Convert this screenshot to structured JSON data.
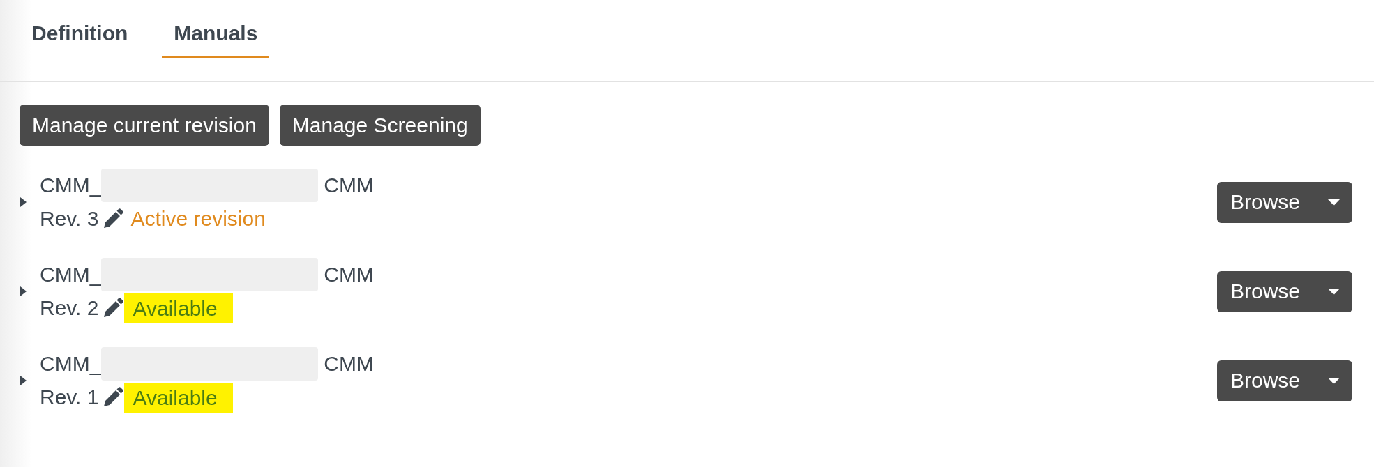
{
  "tabs": [
    {
      "label": "Definition",
      "selected": false
    },
    {
      "label": "Manuals",
      "selected": true
    }
  ],
  "actions": [
    "Manage current revision",
    "Manage Screening"
  ],
  "manuals": [
    {
      "expanded": false,
      "title_start": "CMM_",
      "title_end": "CMM",
      "revision": "Rev. 3",
      "status": {
        "kind": "active",
        "label": "Active revision"
      },
      "menu_button": "Browse"
    },
    {
      "expanded": false,
      "title_start": "CMM_",
      "title_end": "CMM",
      "revision": "Rev. 2",
      "status": {
        "kind": "available",
        "label": "Available"
      },
      "menu_button": "Browse"
    },
    {
      "expanded": false,
      "title_start": "CMM_",
      "title_end": "CMM",
      "revision": "Rev. 1",
      "status": {
        "kind": "available",
        "label": "Available"
      },
      "menu_button": "Browse"
    }
  ]
}
